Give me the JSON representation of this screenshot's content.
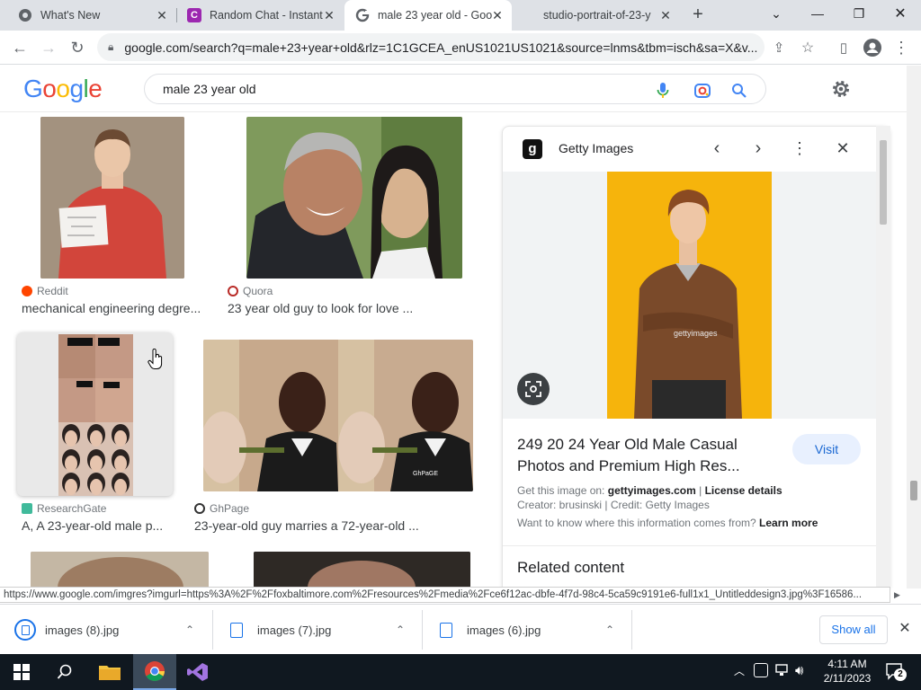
{
  "tabs": [
    {
      "title": "What's New",
      "favicon": "chrome-icon"
    },
    {
      "title": "Random Chat - Instant",
      "favicon": "c-icon"
    },
    {
      "title": "male 23 year old - Goo",
      "favicon": "google-icon",
      "active": true
    },
    {
      "title": "studio-portrait-of-23-y",
      "favicon": "none"
    }
  ],
  "address": {
    "url": "google.com/search?q=male+23+year+old&rlz=1C1GCEA_enUS1021US1021&source=lnms&tbm=isch&sa=X&v..."
  },
  "google": {
    "logo": [
      "G",
      "o",
      "o",
      "g",
      "l",
      "e"
    ],
    "query": "male 23 year old"
  },
  "results": [
    {
      "source": "Reddit",
      "caption": "mechanical engineering degre..."
    },
    {
      "source": "Quora",
      "caption": "23 year old guy to look for love ..."
    },
    {
      "source": "ResearchGate",
      "caption": "A, A 23-year-old male p..."
    },
    {
      "source": "GhPage",
      "caption": "23-year-old guy marries a 72-year-old ..."
    }
  ],
  "watermark_ghpage": "GhPaGE",
  "panel": {
    "site": "Getty Images",
    "title": "249 20 24 Year Old Male Casual Photos and Premium High Res...",
    "visit": "Visit",
    "get_image_label": "Get this image on:",
    "get_image_site": "gettyimages.com",
    "license_details": "License details",
    "credit": "Creator: brusinski | Credit: Getty Images",
    "info_question": "Want to know where this information comes from?",
    "learn_more": "Learn more",
    "related": "Related content",
    "watermark": "gettyimages"
  },
  "status_url": "https://www.google.com/imgres?imgurl=https%3A%2F%2Ffoxbaltimore.com%2Fresources%2Fmedia%2Fce6f12ac-dbfe-4f7d-98c4-5ca59c9191e6-full1x1_Untitleddesign3.jpg%3F16586...",
  "downloads": [
    {
      "name": "images (8).jpg"
    },
    {
      "name": "images (7).jpg"
    },
    {
      "name": "images (6).jpg"
    }
  ],
  "show_all": "Show all",
  "clock": {
    "time": "4:11 AM",
    "date": "2/11/2023"
  },
  "notification_count": "2",
  "colors": {
    "accent": "#1a73e8",
    "taskbar": "#101820",
    "tabstrip": "#dee1e6"
  }
}
